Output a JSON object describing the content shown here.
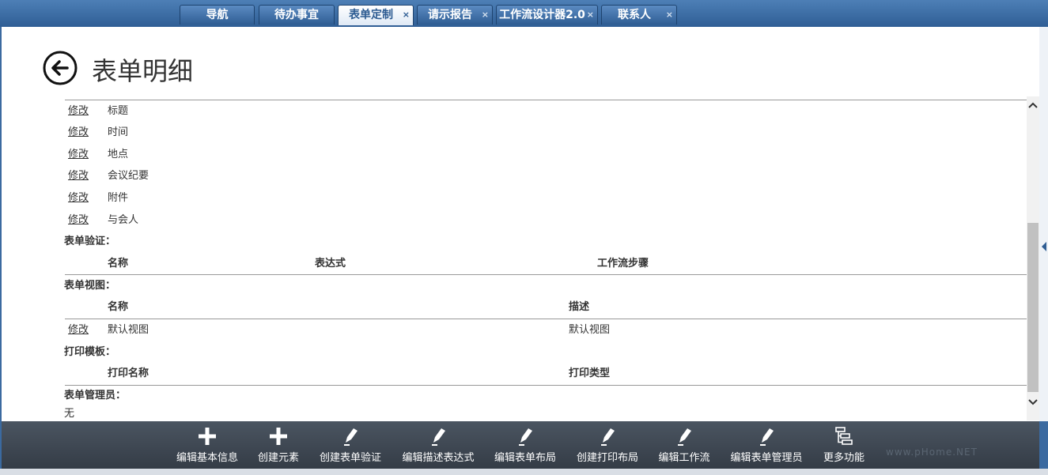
{
  "tabs": [
    {
      "label": "导航",
      "closable": false,
      "active": false
    },
    {
      "label": "待办事宜",
      "closable": false,
      "active": false
    },
    {
      "label": "表单定制",
      "closable": true,
      "active": true
    },
    {
      "label": "请示报告",
      "closable": true,
      "active": false
    },
    {
      "label": "工作流设计器2.0",
      "closable": true,
      "active": false
    },
    {
      "label": "联系人",
      "closable": true,
      "active": false
    }
  ],
  "close_glyph": "×",
  "page": {
    "title": "表单明细",
    "back_icon": "arrow-left-circle-icon"
  },
  "fields": [
    {
      "action": "修改",
      "name": "标题"
    },
    {
      "action": "修改",
      "name": "时间"
    },
    {
      "action": "修改",
      "name": "地点"
    },
    {
      "action": "修改",
      "name": "会议纪要"
    },
    {
      "action": "修改",
      "name": "附件"
    },
    {
      "action": "修改",
      "name": "与会人"
    }
  ],
  "validation": {
    "heading": "表单验证：",
    "columns": [
      "名称",
      "表达式",
      "工作流步骤"
    ]
  },
  "views": {
    "heading": "表单视图：",
    "columns": [
      "名称",
      "描述"
    ],
    "rows": [
      {
        "action": "修改",
        "name": "默认视图",
        "description": "默认视图"
      }
    ]
  },
  "print_templates": {
    "heading": "打印模板：",
    "columns": [
      "打印名称",
      "打印类型"
    ]
  },
  "admins": {
    "heading": "表单管理员：",
    "value": "无"
  },
  "toolbar": [
    {
      "label": "编辑基本信息",
      "icon": "plus-icon"
    },
    {
      "label": "创建元素",
      "icon": "plus-icon"
    },
    {
      "label": "创建表单验证",
      "icon": "pencil-icon"
    },
    {
      "label": "编辑描述表达式",
      "icon": "pencil-icon"
    },
    {
      "label": "编辑表单布局",
      "icon": "pencil-icon"
    },
    {
      "label": "创建打印布局",
      "icon": "pencil-icon"
    },
    {
      "label": "编辑工作流",
      "icon": "pencil-icon"
    },
    {
      "label": "编辑表单管理员",
      "icon": "pencil-icon"
    },
    {
      "label": "更多功能",
      "icon": "tree-icon"
    }
  ],
  "watermark": "www.pHome.NET"
}
